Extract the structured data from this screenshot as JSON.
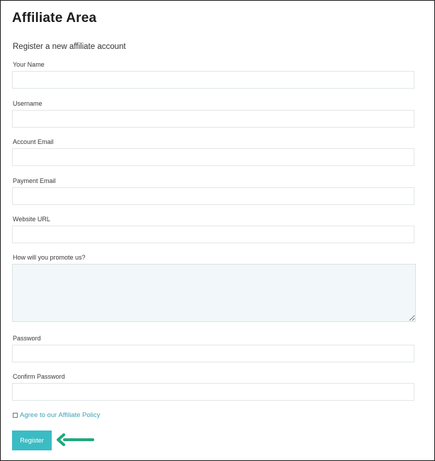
{
  "page": {
    "title": "Affiliate Area",
    "subtitle": "Register a new affiliate account"
  },
  "form": {
    "fields": {
      "name": {
        "label": "Your Name",
        "value": ""
      },
      "username": {
        "label": "Username",
        "value": ""
      },
      "account_email": {
        "label": "Account Email",
        "value": ""
      },
      "payment_email": {
        "label": "Payment Email",
        "value": ""
      },
      "website_url": {
        "label": "Website URL",
        "value": ""
      },
      "promote": {
        "label": "How will you promote us?",
        "value": ""
      },
      "password": {
        "label": "Password",
        "value": ""
      },
      "confirm_password": {
        "label": "Confirm Password",
        "value": ""
      }
    },
    "terms": {
      "link_label": "Agree to our Affiliate Policy",
      "checked": false
    },
    "submit_label": "Register"
  },
  "colors": {
    "accent": "#3bbcc4",
    "link": "#3aa5b7",
    "arrow": "#1fa97d",
    "textarea_bg": "#f2f7f9"
  },
  "icons": {
    "annotation_arrow": "left-arrow-icon"
  }
}
